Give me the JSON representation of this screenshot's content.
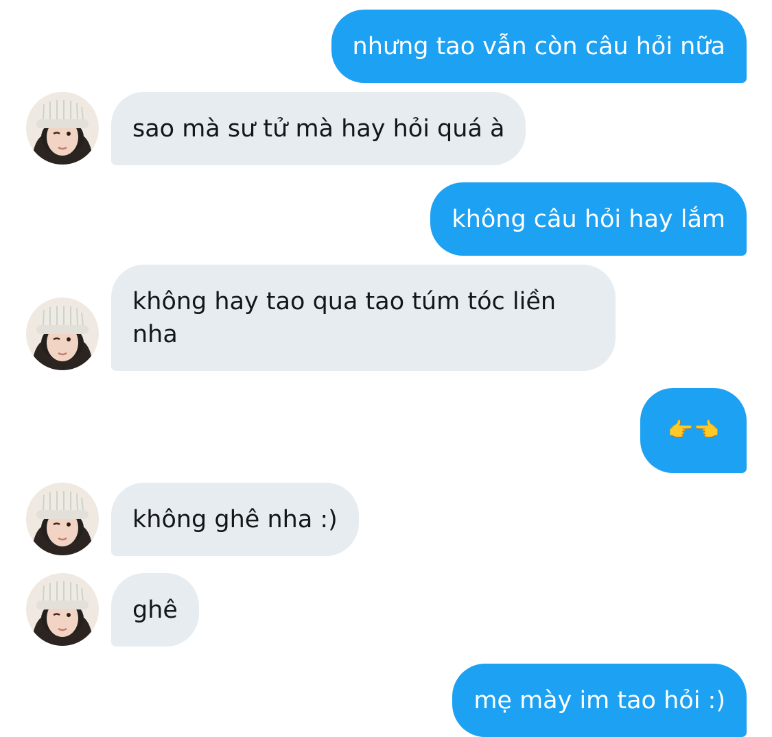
{
  "messages": [
    {
      "from": "me",
      "text": "nhưng tao vẫn còn câu hỏi nữa"
    },
    {
      "from": "them",
      "text": "sao mà sư tử mà hay hỏi quá à"
    },
    {
      "from": "me",
      "text": "không câu hỏi hay lắm"
    },
    {
      "from": "them",
      "text": "không hay tao qua tao túm tóc liền nha"
    },
    {
      "from": "me",
      "text": "👉👈"
    },
    {
      "from": "them",
      "text": "không ghê nha :)"
    },
    {
      "from": "them",
      "text": "ghê"
    },
    {
      "from": "me",
      "text": "mẹ mày im tao hỏi :)"
    }
  ],
  "colors": {
    "outgoing_bubble": "#1da1f2",
    "incoming_bubble": "#e6ecf0",
    "outgoing_text": "#ffffff",
    "incoming_text": "#14171a"
  },
  "icons": {
    "avatar": "contact-avatar-photo"
  }
}
